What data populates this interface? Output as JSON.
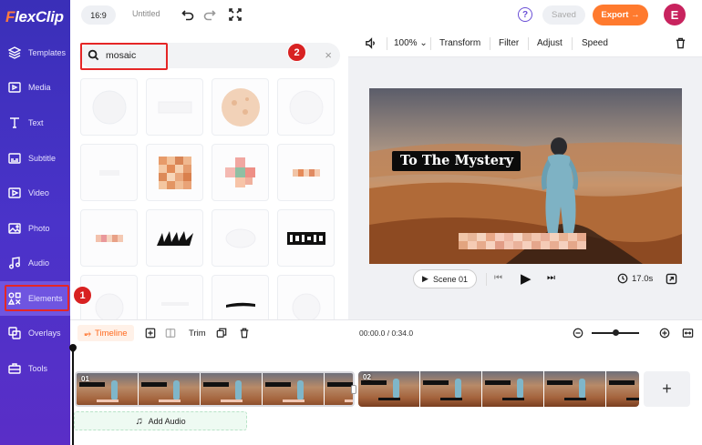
{
  "app": {
    "logo_part1": "F",
    "logo_part2": "lexClip"
  },
  "topbar": {
    "ratio": "16:9",
    "project_name": "Untitled",
    "help": "?",
    "saved": "Saved",
    "export": "Export →",
    "avatar_initial": "E"
  },
  "sidebar": {
    "items": [
      {
        "label": "Templates",
        "icon": "layers-icon"
      },
      {
        "label": "Media",
        "icon": "media-icon"
      },
      {
        "label": "Text",
        "icon": "text-icon"
      },
      {
        "label": "Subtitle",
        "icon": "subtitle-icon"
      },
      {
        "label": "Video",
        "icon": "video-icon"
      },
      {
        "label": "Photo",
        "icon": "photo-icon"
      },
      {
        "label": "Audio",
        "icon": "audio-icon"
      },
      {
        "label": "Elements",
        "icon": "elements-icon"
      },
      {
        "label": "Overlays",
        "icon": "overlays-icon"
      },
      {
        "label": "Tools",
        "icon": "tools-icon"
      }
    ],
    "active": "Elements"
  },
  "annotations": {
    "badge1": "1",
    "badge2": "2"
  },
  "search": {
    "value": "mosaic",
    "placeholder": "",
    "clear": "×"
  },
  "preview_toolbar": {
    "zoom": "100%",
    "transform": "Transform",
    "filter": "Filter",
    "adjust": "Adjust",
    "speed": "Speed"
  },
  "video": {
    "title_text": "To The Mystery"
  },
  "player": {
    "scene_label": "Scene  01",
    "duration": "17.0s"
  },
  "timeline": {
    "tab_label": "Timeline",
    "trim": "Trim",
    "timecode": "00:00.0 / 0:34.0",
    "clips": [
      {
        "num": "01"
      },
      {
        "num": "02"
      }
    ],
    "add_clip": "+",
    "add_audio": "Add Audio"
  },
  "colors": {
    "accent": "#ff7a2e",
    "sidebar": "#4a33c9",
    "highlight": "#e52626"
  }
}
